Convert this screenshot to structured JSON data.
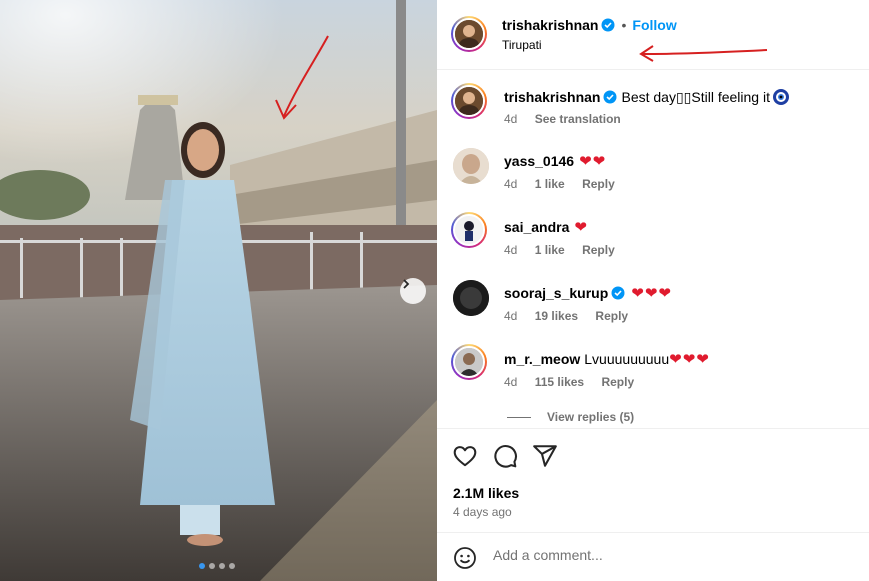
{
  "header": {
    "username": "trishakrishnan",
    "follow_label": "Follow",
    "location": "Tirupati",
    "separator": "•"
  },
  "caption": {
    "username": "trishakrishnan",
    "text": "Best day▯▯Still feeling it",
    "time": "4d",
    "see_translation": "See translation"
  },
  "comments": [
    {
      "username": "yass_0146",
      "text": "",
      "hearts": "❤❤",
      "time": "4d",
      "likes": "1 like",
      "reply": "Reply",
      "verified": false
    },
    {
      "username": "sai_andra",
      "text": "",
      "hearts": "❤",
      "time": "4d",
      "likes": "1 like",
      "reply": "Reply",
      "verified": false
    },
    {
      "username": "sooraj_s_kurup",
      "text": "",
      "hearts": "❤❤❤",
      "time": "4d",
      "likes": "19 likes",
      "reply": "Reply",
      "verified": true
    },
    {
      "username": "m_r._meow",
      "text": "Lvuuuuuuuuu",
      "hearts": "❤❤❤",
      "time": "4d",
      "likes": "115 likes",
      "reply": "Reply",
      "verified": false
    }
  ],
  "view_replies": "View replies (5)",
  "post": {
    "likes": "2.1M likes",
    "ago": "4 days ago"
  },
  "add_comment": {
    "placeholder": "Add a comment..."
  },
  "carousel": {
    "slide_count": 4,
    "active_index": 0
  },
  "icons": [
    "heart-icon",
    "comment-icon",
    "share-icon",
    "emoji-icon",
    "verified-badge-icon",
    "next-arrow-icon"
  ],
  "colors": {
    "follow": "#0095f6",
    "verified": "#0095f6",
    "heart": "#e01b2e",
    "muted": "#737373",
    "annotation": "#d62020"
  }
}
